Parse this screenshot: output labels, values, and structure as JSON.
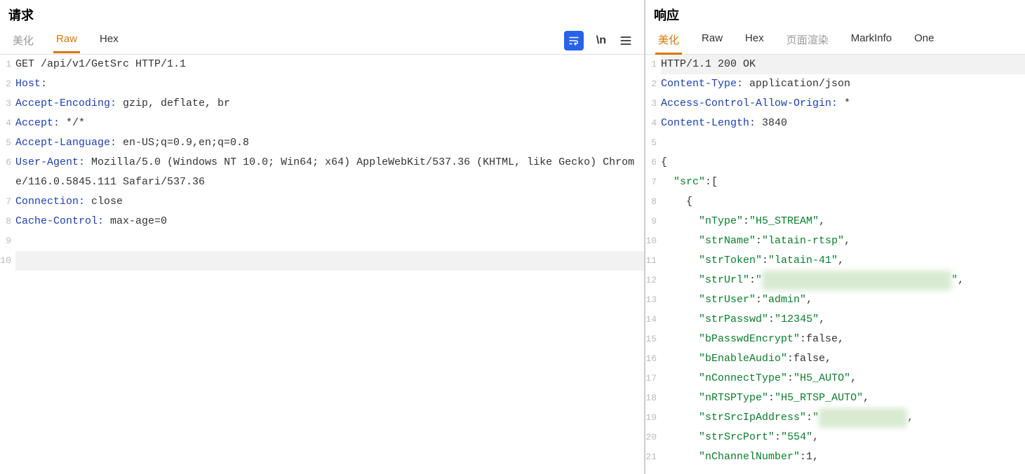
{
  "request": {
    "title": "请求",
    "tabs": [
      {
        "label": "美化",
        "active": false,
        "muted": true
      },
      {
        "label": "Raw",
        "active": true,
        "muted": false
      },
      {
        "label": "Hex",
        "active": false,
        "muted": false
      }
    ],
    "lines": [
      {
        "n": 1,
        "segs": [
          {
            "t": "GET /api/v1/GetSrc HTTP/1.1",
            "c": ""
          }
        ]
      },
      {
        "n": 2,
        "segs": [
          {
            "t": "Host:",
            "c": "h"
          }
        ]
      },
      {
        "n": 3,
        "segs": [
          {
            "t": "Accept-Encoding:",
            "c": "h"
          },
          {
            "t": " gzip, deflate, br",
            "c": ""
          }
        ]
      },
      {
        "n": 4,
        "segs": [
          {
            "t": "Accept:",
            "c": "h"
          },
          {
            "t": " */*",
            "c": ""
          }
        ]
      },
      {
        "n": 5,
        "segs": [
          {
            "t": "Accept-Language:",
            "c": "h"
          },
          {
            "t": " en-US;q=0.9,en;q=0.8",
            "c": ""
          }
        ]
      },
      {
        "n": 6,
        "segs": [
          {
            "t": "User-Agent:",
            "c": "h"
          },
          {
            "t": " Mozilla/5.0 (Windows NT 10.0; Win64; x64) AppleWebKit/537.36 (KHTML, like Gecko) Chrome/116.0.5845.111 Safari/537.36",
            "c": ""
          }
        ]
      },
      {
        "n": 7,
        "segs": [
          {
            "t": "Connection:",
            "c": "h"
          },
          {
            "t": " close",
            "c": ""
          }
        ]
      },
      {
        "n": 8,
        "segs": [
          {
            "t": "Cache-Control:",
            "c": "h"
          },
          {
            "t": " max-age=0",
            "c": ""
          }
        ]
      },
      {
        "n": 9,
        "segs": []
      },
      {
        "n": 10,
        "segs": [],
        "hl": true
      }
    ]
  },
  "response": {
    "title": "响应",
    "tabs": [
      {
        "label": "美化",
        "active": true,
        "muted": false
      },
      {
        "label": "Raw",
        "active": false,
        "muted": false
      },
      {
        "label": "Hex",
        "active": false,
        "muted": false
      },
      {
        "label": "页面渲染",
        "active": false,
        "muted": true
      },
      {
        "label": "MarkInfo",
        "active": false,
        "muted": false
      },
      {
        "label": "One",
        "active": false,
        "muted": false
      }
    ],
    "lines": [
      {
        "n": 1,
        "hl": true,
        "segs": [
          {
            "t": "HTTP/1.1 200 OK",
            "c": ""
          }
        ]
      },
      {
        "n": 2,
        "segs": [
          {
            "t": "Content-Type:",
            "c": "h"
          },
          {
            "t": " application/json",
            "c": ""
          }
        ]
      },
      {
        "n": 3,
        "segs": [
          {
            "t": "Access-Control-Allow-Origin:",
            "c": "h"
          },
          {
            "t": " *",
            "c": ""
          }
        ]
      },
      {
        "n": 4,
        "segs": [
          {
            "t": "Content-Length:",
            "c": "h"
          },
          {
            "t": " 3840",
            "c": ""
          }
        ]
      },
      {
        "n": 5,
        "segs": []
      },
      {
        "n": 6,
        "segs": [
          {
            "t": "{",
            "c": ""
          }
        ]
      },
      {
        "n": 7,
        "segs": [
          {
            "t": "  ",
            "c": ""
          },
          {
            "t": "\"src\"",
            "c": "s"
          },
          {
            "t": ":[",
            "c": ""
          }
        ]
      },
      {
        "n": 8,
        "segs": [
          {
            "t": "    {",
            "c": ""
          }
        ]
      },
      {
        "n": 9,
        "segs": [
          {
            "t": "      ",
            "c": ""
          },
          {
            "t": "\"nType\"",
            "c": "s"
          },
          {
            "t": ":",
            "c": ""
          },
          {
            "t": "\"H5_STREAM\"",
            "c": "s"
          },
          {
            "t": ",",
            "c": ""
          }
        ]
      },
      {
        "n": 10,
        "segs": [
          {
            "t": "      ",
            "c": ""
          },
          {
            "t": "\"strName\"",
            "c": "s"
          },
          {
            "t": ":",
            "c": ""
          },
          {
            "t": "\"latain-rtsp\"",
            "c": "s"
          },
          {
            "t": ",",
            "c": ""
          }
        ]
      },
      {
        "n": 11,
        "segs": [
          {
            "t": "      ",
            "c": ""
          },
          {
            "t": "\"strToken\"",
            "c": "s"
          },
          {
            "t": ":",
            "c": ""
          },
          {
            "t": "\"latain-41\"",
            "c": "s"
          },
          {
            "t": ",",
            "c": ""
          }
        ]
      },
      {
        "n": 12,
        "segs": [
          {
            "t": "      ",
            "c": ""
          },
          {
            "t": "\"strUrl\"",
            "c": "s"
          },
          {
            "t": ":",
            "c": ""
          },
          {
            "t": "\"",
            "c": "s"
          },
          {
            "t": "                              ",
            "c": "b"
          },
          {
            "t": "\"",
            "c": "s"
          },
          {
            "t": ",",
            "c": ""
          }
        ]
      },
      {
        "n": 13,
        "segs": [
          {
            "t": "      ",
            "c": ""
          },
          {
            "t": "\"strUser\"",
            "c": "s"
          },
          {
            "t": ":",
            "c": ""
          },
          {
            "t": "\"admin\"",
            "c": "s"
          },
          {
            "t": ",",
            "c": ""
          }
        ]
      },
      {
        "n": 14,
        "segs": [
          {
            "t": "      ",
            "c": ""
          },
          {
            "t": "\"strPasswd\"",
            "c": "s"
          },
          {
            "t": ":",
            "c": ""
          },
          {
            "t": "\"12345\"",
            "c": "s"
          },
          {
            "t": ",",
            "c": ""
          }
        ]
      },
      {
        "n": 15,
        "segs": [
          {
            "t": "      ",
            "c": ""
          },
          {
            "t": "\"bPasswdEncrypt\"",
            "c": "s"
          },
          {
            "t": ":false,",
            "c": ""
          }
        ]
      },
      {
        "n": 16,
        "segs": [
          {
            "t": "      ",
            "c": ""
          },
          {
            "t": "\"bEnableAudio\"",
            "c": "s"
          },
          {
            "t": ":false,",
            "c": ""
          }
        ]
      },
      {
        "n": 17,
        "segs": [
          {
            "t": "      ",
            "c": ""
          },
          {
            "t": "\"nConnectType\"",
            "c": "s"
          },
          {
            "t": ":",
            "c": ""
          },
          {
            "t": "\"H5_AUTO\"",
            "c": "s"
          },
          {
            "t": ",",
            "c": ""
          }
        ]
      },
      {
        "n": 18,
        "segs": [
          {
            "t": "      ",
            "c": ""
          },
          {
            "t": "\"nRTSPType\"",
            "c": "s"
          },
          {
            "t": ":",
            "c": ""
          },
          {
            "t": "\"H5_RTSP_AUTO\"",
            "c": "s"
          },
          {
            "t": ",",
            "c": ""
          }
        ]
      },
      {
        "n": 19,
        "segs": [
          {
            "t": "      ",
            "c": ""
          },
          {
            "t": "\"strSrcIpAddress\"",
            "c": "s"
          },
          {
            "t": ":",
            "c": ""
          },
          {
            "t": "\"",
            "c": "s"
          },
          {
            "t": "              ",
            "c": "b"
          },
          {
            "t": ",",
            "c": ""
          }
        ]
      },
      {
        "n": 20,
        "segs": [
          {
            "t": "      ",
            "c": ""
          },
          {
            "t": "\"strSrcPort\"",
            "c": "s"
          },
          {
            "t": ":",
            "c": ""
          },
          {
            "t": "\"554\"",
            "c": "s"
          },
          {
            "t": ",",
            "c": ""
          }
        ]
      },
      {
        "n": 21,
        "segs": [
          {
            "t": "      ",
            "c": ""
          },
          {
            "t": "\"nChannelNumber\"",
            "c": "s"
          },
          {
            "t": ":1,",
            "c": ""
          }
        ]
      }
    ]
  }
}
